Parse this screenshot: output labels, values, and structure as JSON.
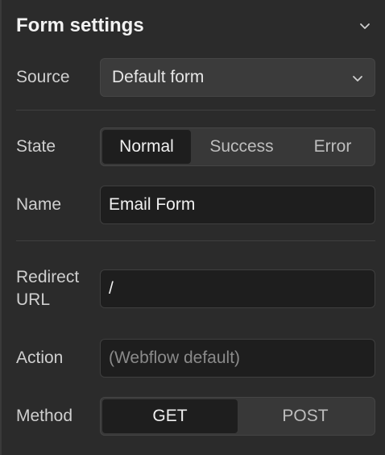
{
  "header": {
    "title": "Form settings",
    "collapse_icon": "chevron-down-icon"
  },
  "source": {
    "label": "Source",
    "value": "Default form",
    "icon": "chevron-down-icon"
  },
  "state": {
    "label": "State",
    "options": [
      "Normal",
      "Success",
      "Error"
    ],
    "selected": "Normal"
  },
  "name": {
    "label": "Name",
    "value": "Email Form"
  },
  "redirect": {
    "label_line1": "Redirect",
    "label_line2": "URL",
    "value": "/"
  },
  "action": {
    "label": "Action",
    "placeholder": "(Webflow default)"
  },
  "method": {
    "label": "Method",
    "options": [
      "GET",
      "POST"
    ],
    "selected": "GET"
  }
}
